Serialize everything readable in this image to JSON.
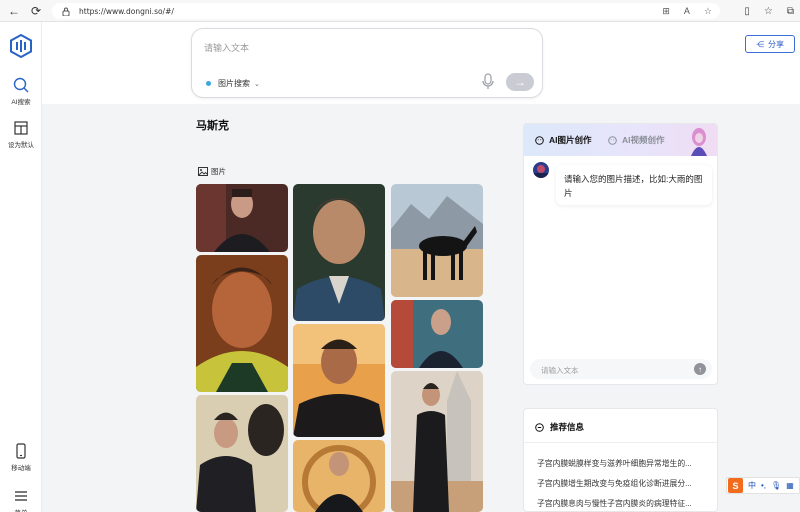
{
  "browser": {
    "url": "https://www.dongni.so/#/",
    "icons": [
      "back-arrow-icon",
      "reload-icon",
      "lock-icon",
      "reader-view-icon",
      "read-aloud-icon",
      "favorite-star-icon",
      "split-screen-icon",
      "favorites-icon",
      "collections-icon"
    ]
  },
  "sidebar": {
    "items": [
      {
        "label": "AI搜索",
        "icon": "search-icon"
      },
      {
        "label": "设为默认",
        "icon": "layout-icon"
      },
      {
        "label": "移动端",
        "icon": "mobile-icon"
      },
      {
        "label": "菜单",
        "icon": "menu-icon"
      }
    ]
  },
  "search": {
    "placeholder": "请输入文本",
    "mode_label": "图片搜索",
    "share_label": "分享"
  },
  "main": {
    "title": "马斯克",
    "section_label": "图片"
  },
  "ai_panel": {
    "tab_active": "AI图片创作",
    "tab_inactive": "AI视频创作",
    "bot_message": "请输入您的图片描述，比如:大雨的图片",
    "input_placeholder": "请输入文本"
  },
  "recommend": {
    "title": "推荐信息",
    "items": [
      "子宫内膜蜕膜样变与滋养叶细胞异常增生的...",
      "子宫内膜增生期改变与免疫组化诊断进展分...",
      "子宫内膜息肉与慢性子宫内膜炎的病理特征..."
    ]
  },
  "ime": {
    "logo": "S",
    "mode": "中",
    "punct": "•,"
  },
  "colors": {
    "accent": "#2f5fc8",
    "mode_dot": "#3aa8e0",
    "ime_orange": "#f36c1d"
  }
}
